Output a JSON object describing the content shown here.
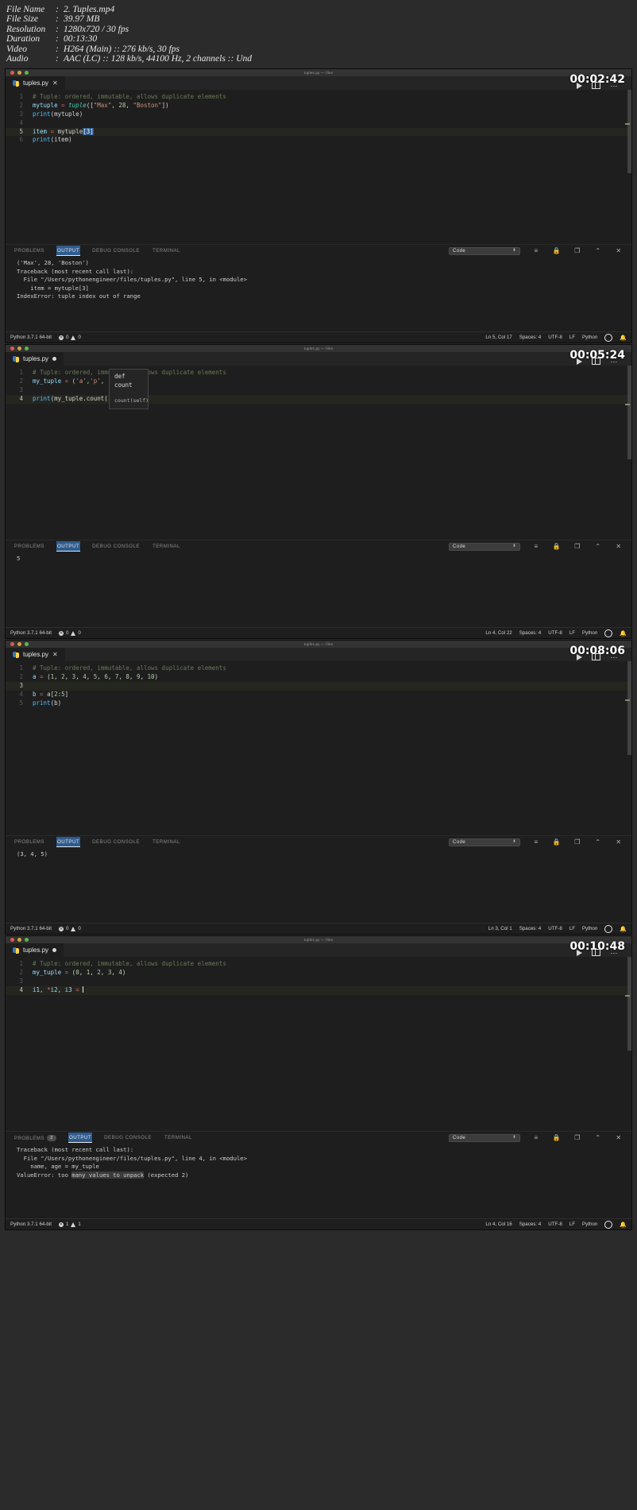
{
  "meta": {
    "rows": [
      {
        "key": "File Name",
        "sep": ":",
        "value": "2. Tuples.mp4"
      },
      {
        "key": "File Size",
        "sep": ":",
        "value": "39.97 MB"
      },
      {
        "key": "Resolution",
        "sep": ":",
        "value": "1280x720 / 30 fps"
      },
      {
        "key": "Duration",
        "sep": ":",
        "value": "00:13:30"
      },
      {
        "key": "Video",
        "sep": ":",
        "value": "H264 (Main) :: 276 kb/s, 30 fps"
      },
      {
        "key": "Audio",
        "sep": ":",
        "value": "AAC (LC) :: 128 kb/s, 44100 Hz, 2 channels :: Und"
      }
    ]
  },
  "window_title": "tuples.py — files",
  "panel_tabs": {
    "problems": "PROBLEMS",
    "output": "OUTPUT",
    "debug": "DEBUG CONSOLE",
    "terminal": "TERMINAL",
    "select_value": "Code"
  },
  "status_common": {
    "interpreter": "Python 3.7.1 64-bit",
    "spaces": "Spaces: 4",
    "encoding": "UTF-8",
    "eol": "LF",
    "language": "Python"
  },
  "tooltip": {
    "head": "def count",
    "body": "count(self)"
  },
  "frames": [
    {
      "id": "frame-1",
      "timer": "00:02:42",
      "tab": {
        "label": "tuples.py",
        "state": "close"
      },
      "lines": [
        {
          "n": "1",
          "active": false,
          "tokens": [
            {
              "t": "# Tuple: ordered, immutable, allows duplicate elements",
              "c": "cm"
            }
          ]
        },
        {
          "n": "2",
          "active": false,
          "tokens": [
            {
              "t": "mytuple ",
              "c": "va"
            },
            {
              "t": "= ",
              "c": "op"
            },
            {
              "t": "tuple",
              "c": "bi"
            },
            {
              "t": "([",
              "c": ""
            },
            {
              "t": "\"Max\"",
              "c": "st"
            },
            {
              "t": ", ",
              "c": ""
            },
            {
              "t": "28",
              "c": "nu"
            },
            {
              "t": ", ",
              "c": ""
            },
            {
              "t": "\"Boston\"",
              "c": "st"
            },
            {
              "t": "])",
              "c": ""
            }
          ]
        },
        {
          "n": "3",
          "active": false,
          "tokens": [
            {
              "t": "print",
              "c": "call"
            },
            {
              "t": "(mytuple)",
              "c": ""
            }
          ]
        },
        {
          "n": "4",
          "active": false,
          "tokens": []
        },
        {
          "n": "5",
          "active": true,
          "tokens": [
            {
              "t": "item ",
              "c": "va"
            },
            {
              "t": "= ",
              "c": "op"
            },
            {
              "t": "mytuple",
              "c": ""
            },
            {
              "t": "[3]",
              "c": "sel"
            }
          ]
        },
        {
          "n": "6",
          "active": false,
          "tokens": [
            {
              "t": "print",
              "c": "call"
            },
            {
              "t": "(item)",
              "c": ""
            }
          ]
        }
      ],
      "output": [
        {
          "t": "('Max', 28, 'Boston')"
        },
        {
          "t": "Traceback (most recent call last):"
        },
        {
          "t": "  File \"/Users/pythonengineer/files/tuples.py\", line 5, in <module>"
        },
        {
          "t": "    item = mytuple[3]"
        },
        {
          "t": "IndexError: tuple index out of range"
        }
      ],
      "problems_count": "",
      "status": {
        "errors": "0",
        "warnings": "0",
        "cursor": "Ln 5, Col 17"
      },
      "editor_height": 190,
      "output_height": 88
    },
    {
      "id": "frame-2",
      "timer": "00:05:24",
      "tab": {
        "label": "tuples.py",
        "state": "dirty"
      },
      "lines": [
        {
          "n": "1",
          "active": false,
          "tokens": [
            {
              "t": "# Tuple: ordered, immutable, allows duplicate elements",
              "c": "cm"
            }
          ]
        },
        {
          "n": "2",
          "active": false,
          "tokens": [
            {
              "t": "my_tuple ",
              "c": "va"
            },
            {
              "t": "= ",
              "c": "op"
            },
            {
              "t": "(",
              "c": ""
            },
            {
              "t": "'a'",
              "c": "st"
            },
            {
              "t": ",",
              "c": ""
            },
            {
              "t": "'p'",
              "c": "st"
            },
            {
              "t": ",",
              "c": ""
            }
          ]
        },
        {
          "n": "3",
          "active": false,
          "tokens": []
        },
        {
          "n": "4",
          "active": true,
          "tokens": [
            {
              "t": "print",
              "c": "call"
            },
            {
              "t": "(my_tuple.count())",
              "c": ""
            }
          ]
        }
      ],
      "output": [
        {
          "t": "5"
        }
      ],
      "problems_count": "",
      "status": {
        "errors": "0",
        "warnings": "0",
        "cursor": "Ln 4, Col 22"
      },
      "editor_height": 215,
      "output_height": 88,
      "has_tooltip": true
    },
    {
      "id": "frame-3",
      "timer": "00:08:06",
      "tab": {
        "label": "tuples.py",
        "state": "close"
      },
      "lines": [
        {
          "n": "1",
          "active": false,
          "tokens": [
            {
              "t": "# Tuple: ordered, immutable, allows duplicate elements",
              "c": "cm"
            }
          ]
        },
        {
          "n": "2",
          "active": false,
          "tokens": [
            {
              "t": "a ",
              "c": "va"
            },
            {
              "t": "= ",
              "c": "op"
            },
            {
              "t": "(",
              "c": ""
            },
            {
              "t": "1",
              "c": "nu"
            },
            {
              "t": ", ",
              "c": ""
            },
            {
              "t": "2",
              "c": "nu"
            },
            {
              "t": ", ",
              "c": ""
            },
            {
              "t": "3",
              "c": "nu"
            },
            {
              "t": ", ",
              "c": ""
            },
            {
              "t": "4",
              "c": "nu"
            },
            {
              "t": ", ",
              "c": ""
            },
            {
              "t": "5",
              "c": "nu"
            },
            {
              "t": ", ",
              "c": ""
            },
            {
              "t": "6",
              "c": "nu"
            },
            {
              "t": ", ",
              "c": ""
            },
            {
              "t": "7",
              "c": "nu"
            },
            {
              "t": ", ",
              "c": ""
            },
            {
              "t": "8",
              "c": "nu"
            },
            {
              "t": ", ",
              "c": ""
            },
            {
              "t": "9",
              "c": "nu"
            },
            {
              "t": ", ",
              "c": ""
            },
            {
              "t": "10",
              "c": "nu"
            },
            {
              "t": ")",
              "c": ""
            }
          ]
        },
        {
          "n": "3",
          "active": true,
          "tokens": []
        },
        {
          "n": "4",
          "active": false,
          "tokens": [
            {
              "t": "b ",
              "c": "va"
            },
            {
              "t": "= ",
              "c": "op"
            },
            {
              "t": "a[",
              "c": ""
            },
            {
              "t": "2",
              "c": "nu"
            },
            {
              "t": ":",
              "c": ""
            },
            {
              "t": "5",
              "c": "nu"
            },
            {
              "t": "]",
              "c": ""
            }
          ]
        },
        {
          "n": "5",
          "active": false,
          "tokens": [
            {
              "t": "print",
              "c": "call"
            },
            {
              "t": "(b)",
              "c": ""
            }
          ]
        }
      ],
      "output": [
        {
          "t": "(3, 4, 5)"
        }
      ],
      "problems_count": "",
      "status": {
        "errors": "0",
        "warnings": "0",
        "cursor": "Ln 3, Col 1"
      },
      "editor_height": 215,
      "output_height": 88
    },
    {
      "id": "frame-4",
      "timer": "00:10:48",
      "tab": {
        "label": "tuples.py",
        "state": "dirty"
      },
      "lines": [
        {
          "n": "1",
          "active": false,
          "tokens": [
            {
              "t": "# Tuple: ordered, immutable, allows duplicate elements",
              "c": "cm"
            }
          ]
        },
        {
          "n": "2",
          "active": false,
          "tokens": [
            {
              "t": "my_tuple ",
              "c": "va"
            },
            {
              "t": "= ",
              "c": "op"
            },
            {
              "t": "(",
              "c": ""
            },
            {
              "t": "0",
              "c": "nu"
            },
            {
              "t": ", ",
              "c": ""
            },
            {
              "t": "1",
              "c": "nu"
            },
            {
              "t": ", ",
              "c": ""
            },
            {
              "t": "2",
              "c": "nu"
            },
            {
              "t": ", ",
              "c": ""
            },
            {
              "t": "3",
              "c": "nu"
            },
            {
              "t": ", ",
              "c": ""
            },
            {
              "t": "4",
              "c": "nu"
            },
            {
              "t": ")",
              "c": ""
            }
          ]
        },
        {
          "n": "3",
          "active": false,
          "tokens": []
        },
        {
          "n": "4",
          "active": true,
          "tokens": [
            {
              "t": "i1, ",
              "c": "va"
            },
            {
              "t": "*",
              "c": "op"
            },
            {
              "t": "i2, i3 ",
              "c": "va"
            },
            {
              "t": "= ",
              "c": "op"
            }
          ],
          "cursor": true
        }
      ],
      "output": [
        {
          "t": "Traceback (most recent call last):"
        },
        {
          "t": "  File \"/Users/pythonengineer/files/tuples.py\", line 4, in <module>"
        },
        {
          "t": "    name, age = my_tuple"
        },
        {
          "t": "ValueError: too many values to unpack (expected 2)",
          "hl": "many values to unpack"
        }
      ],
      "problems_count": "2",
      "status": {
        "errors": "1",
        "warnings": "1",
        "cursor": "Ln 4, Col 16"
      },
      "editor_height": 215,
      "output_height": 88
    }
  ]
}
